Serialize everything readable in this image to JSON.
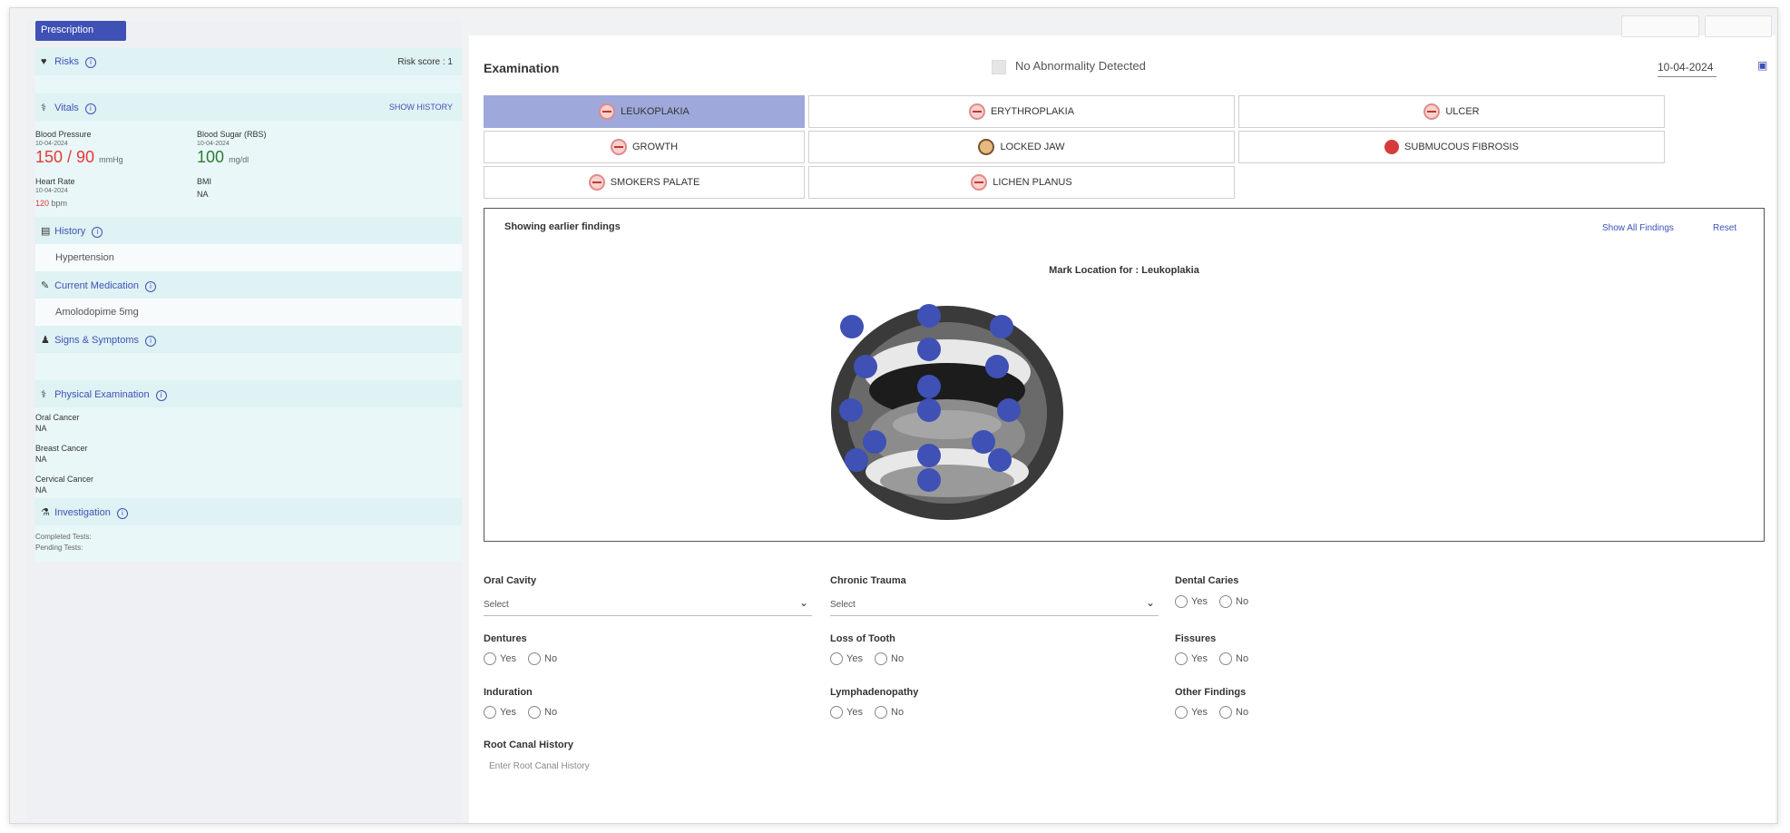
{
  "left": {
    "prescription_label": "Prescription",
    "risks": {
      "title": "Risks",
      "score_label": "Risk score : 1"
    },
    "vitals": {
      "title": "Vitals",
      "show_history": "SHOW HISTORY",
      "bp": {
        "label": "Blood Pressure",
        "date": "10-04-2024",
        "value": "150 / 90",
        "unit": "mmHg"
      },
      "sugar": {
        "label": "Blood Sugar (RBS)",
        "date": "10-04-2024",
        "value": "100",
        "unit": "mg/dl"
      },
      "hr": {
        "label": "Heart Rate",
        "date": "10-04-2024",
        "value": "120",
        "unit": "bpm"
      },
      "bmi": {
        "label": "BMI",
        "value": "NA"
      }
    },
    "history": {
      "title": "History",
      "value": "Hypertension"
    },
    "medication": {
      "title": "Current Medication",
      "value": "Amolodopime 5mg"
    },
    "signs": {
      "title": "Signs & Symptoms"
    },
    "physical": {
      "title": "Physical Examination",
      "items": [
        {
          "label": "Oral Cancer",
          "value": "NA"
        },
        {
          "label": "Breast Cancer",
          "value": "NA"
        },
        {
          "label": "Cervical Cancer",
          "value": "NA"
        }
      ]
    },
    "investigation": {
      "title": "Investigation",
      "completed": "Completed Tests:",
      "pending": "Pending Tests:"
    }
  },
  "exam": {
    "title": "Examination",
    "no_abnormality": "No Abnormality Detected",
    "date": "10-04-2024",
    "conditions": [
      {
        "label": "LEUKOPLAKIA",
        "active": true
      },
      {
        "label": "ERYTHROPLAKIA",
        "active": false
      },
      {
        "label": "ULCER",
        "active": false
      },
      {
        "label": "GROWTH",
        "active": false
      },
      {
        "label": "LOCKED JAW",
        "active": false
      },
      {
        "label": "SUBMUCOUS FIBROSIS",
        "active": false
      },
      {
        "label": "SMOKERS PALATE",
        "active": false
      },
      {
        "label": "LICHEN PLANUS",
        "active": false
      }
    ],
    "earlier_findings": "Showing earlier findings",
    "show_all": "Show All Findings",
    "reset": "Reset",
    "mark_location": "Mark Location for : Leukoplakia"
  },
  "form": {
    "oral_cavity": {
      "label": "Oral Cavity",
      "value": "Select"
    },
    "chronic_trauma": {
      "label": "Chronic Trauma",
      "value": "Select"
    },
    "dental_caries": {
      "label": "Dental Caries"
    },
    "dentures": {
      "label": "Dentures"
    },
    "loss_of_tooth": {
      "label": "Loss of Tooth"
    },
    "fissures": {
      "label": "Fissures"
    },
    "induration": {
      "label": "Induration"
    },
    "lymphadenopathy": {
      "label": "Lymphadenopathy"
    },
    "other_findings": {
      "label": "Other Findings"
    },
    "root_canal": {
      "label": "Root Canal History",
      "placeholder": "Enter Root Canal History"
    },
    "yes": "Yes",
    "no": "No"
  },
  "colors": {
    "accent": "#3f51b5",
    "active_tab": "#9fa8da",
    "bp_red": "#e53935",
    "sugar_green": "#2e7d32"
  }
}
